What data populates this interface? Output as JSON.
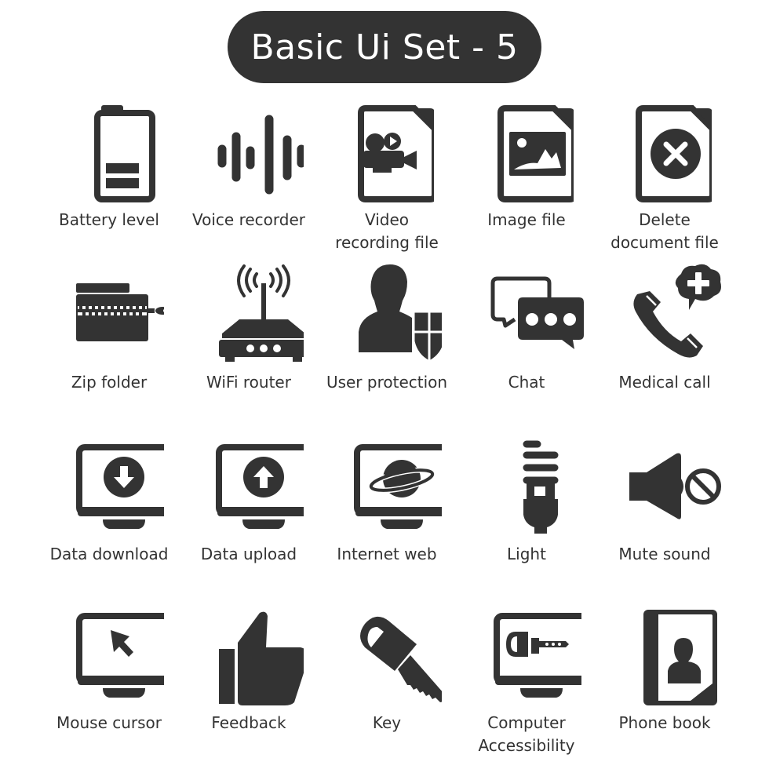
{
  "title": "Basic Ui Set - 5",
  "colors": {
    "icon": "#333333",
    "pill": "#333333",
    "pill_text": "#ffffff",
    "background": "#ffffff"
  },
  "icons": [
    {
      "name": "battery-level",
      "label": "Battery level"
    },
    {
      "name": "voice-recorder",
      "label": "Voice recorder"
    },
    {
      "name": "video-recording-file",
      "label": "Video\nrecording file"
    },
    {
      "name": "image-file",
      "label": "Image file"
    },
    {
      "name": "delete-document-file",
      "label": "Delete\ndocument file"
    },
    {
      "name": "zip-folder",
      "label": "Zip folder"
    },
    {
      "name": "wifi-router",
      "label": "WiFi router"
    },
    {
      "name": "user-protection",
      "label": "User protection"
    },
    {
      "name": "chat",
      "label": "Chat"
    },
    {
      "name": "medical-call",
      "label": "Medical call"
    },
    {
      "name": "data-download",
      "label": "Data download"
    },
    {
      "name": "data-upload",
      "label": "Data upload"
    },
    {
      "name": "internet-web",
      "label": "Internet web"
    },
    {
      "name": "light",
      "label": "Light"
    },
    {
      "name": "mute-sound",
      "label": "Mute sound"
    },
    {
      "name": "mouse-cursor",
      "label": "Mouse cursor"
    },
    {
      "name": "feedback",
      "label": "Feedback"
    },
    {
      "name": "key",
      "label": "Key"
    },
    {
      "name": "computer-accessibility",
      "label": "Computer\nAccessibility"
    },
    {
      "name": "phone-book",
      "label": "Phone book"
    }
  ]
}
